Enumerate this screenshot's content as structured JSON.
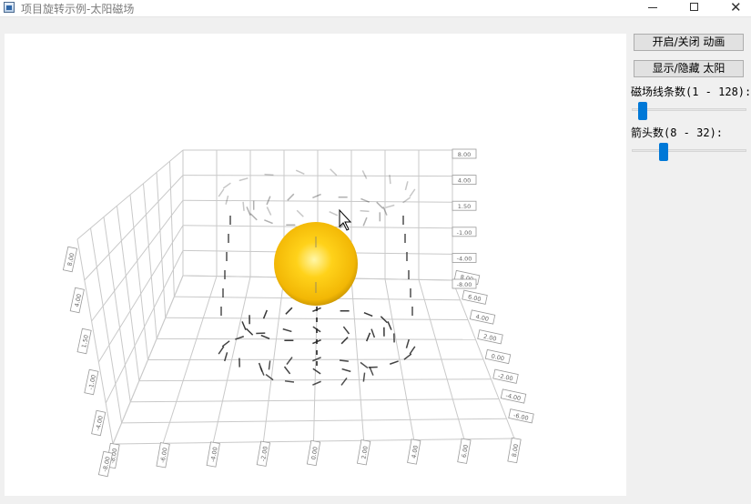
{
  "window": {
    "title": "项目旋转示例-太阳磁场",
    "minimize_icon": "minimize-icon",
    "maximize_icon": "maximize-icon",
    "close_icon": "close-icon"
  },
  "controls": {
    "toggle_animation_label": "开启/关闭 动画",
    "toggle_sun_label": "显示/隐藏 太阳",
    "field_lines_label": "磁场线条数(1 - 128):",
    "field_lines_value": 8,
    "field_lines_min": 1,
    "field_lines_max": 128,
    "arrows_label": "箭头数(8 - 32):",
    "arrows_value": 14,
    "arrows_min": 8,
    "arrows_max": 32
  },
  "plot": {
    "x_ticks": [
      "-8.00",
      "-6.00",
      "-4.00",
      "-2.00",
      "0.00",
      "2.00",
      "4.00",
      "6.00",
      "8.00"
    ],
    "y_ticks": [
      "-8.00",
      "-6.00",
      "-4.00",
      "-2.00",
      "0.00",
      "2.00",
      "4.00",
      "6.00",
      "8.00"
    ],
    "z_ticks_right": [
      "8.00",
      "4.00",
      "1.50",
      "-1.00",
      "-4.00",
      "-8.00"
    ],
    "z_ticks_left": [
      "8.00",
      "4.00",
      "1.50",
      "-1.00",
      "-4.00",
      "-8.00"
    ],
    "sun_color": "#f2b705",
    "sun_highlight": "#fff7a8",
    "grid_color": "#c9c9c9",
    "arrow_color": "#222222"
  }
}
